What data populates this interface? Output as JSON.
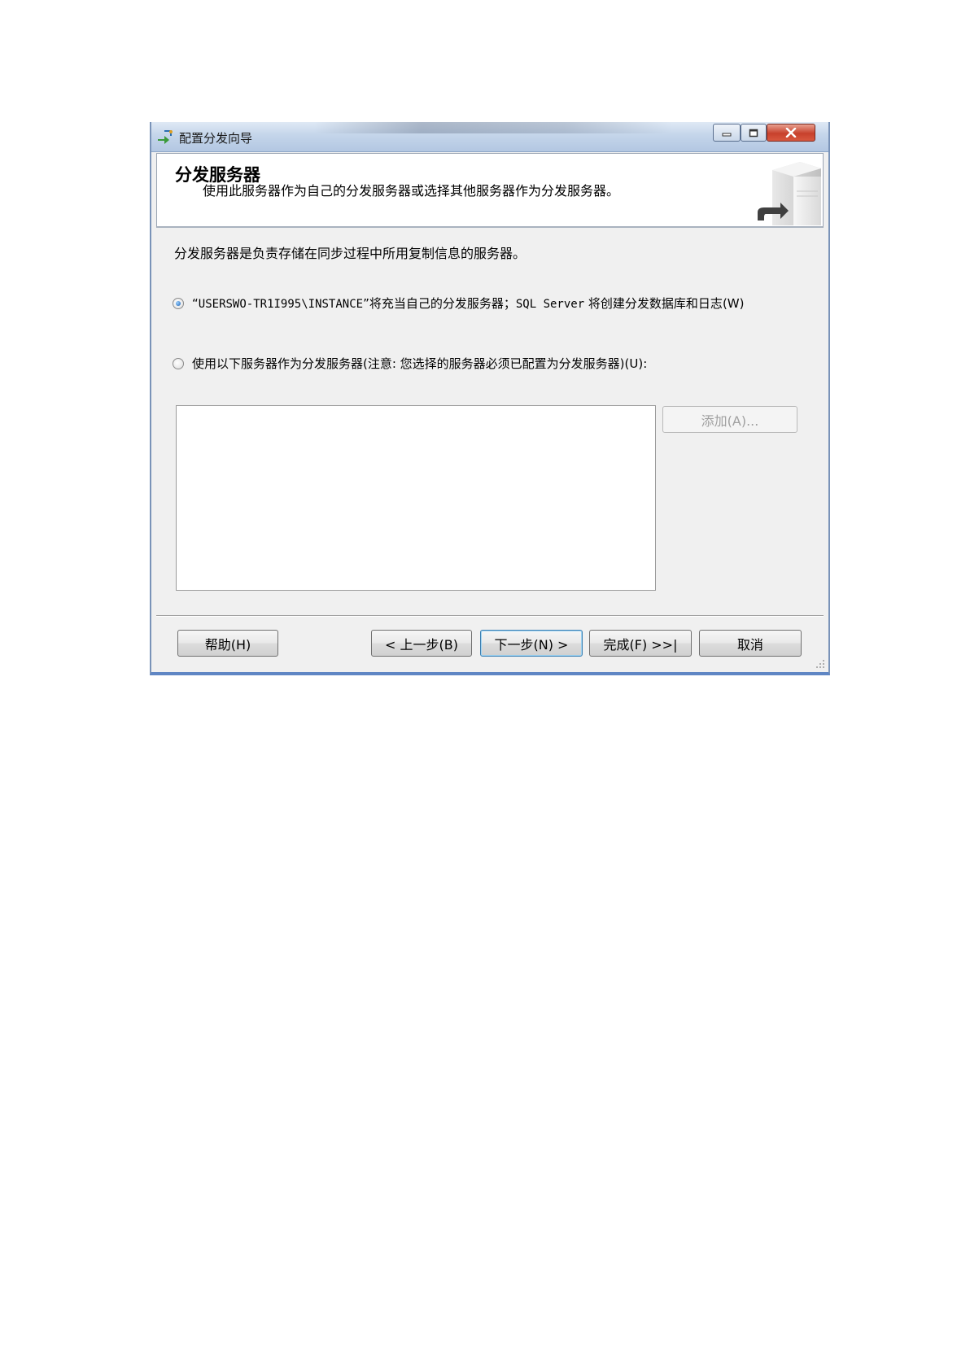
{
  "window": {
    "title": "配置分发向导",
    "icon": "wizard-icon",
    "controls": [
      "minimize-icon",
      "maximize-icon",
      "close-icon"
    ]
  },
  "banner": {
    "title": "分发服务器",
    "subtitle": "使用此服务器作为自己的分发服务器或选择其他服务器作为分发服务器。",
    "icon": "server-icon"
  },
  "intro": "分发服务器是负责存储在同步过程中所用复制信息的服务器。",
  "options": {
    "self": {
      "quote_open": "“",
      "server": "USERSWO-TR1I995\\INSTANCE",
      "text_a": "”将充当自己的分发服务器；",
      "product": "SQL Server",
      "text_b": " 将创建分发数据库和日志",
      "hotkey": "(W)",
      "checked": true
    },
    "other": {
      "text": "使用以下服务器作为分发服务器(注意: 您选择的服务器必须已配置为分发服务器)",
      "hotkey": "(U):",
      "checked": false
    }
  },
  "add_button": "添加(A)...",
  "buttons": {
    "help": "帮助(H)",
    "back": "< 上一步(B)",
    "next": "下一步(N) >",
    "finish": "完成(F) >>|",
    "cancel": "取消"
  }
}
